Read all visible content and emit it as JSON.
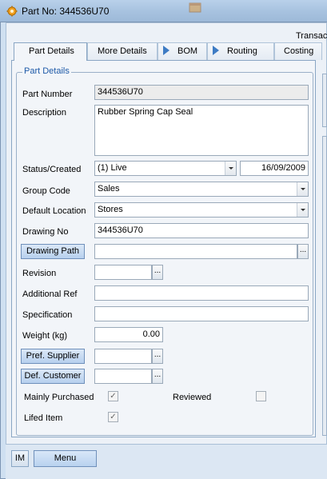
{
  "window": {
    "title": "Part No: 344536U70",
    "header_right": "Transact"
  },
  "tabs": [
    {
      "label": "Part Details",
      "active": true
    },
    {
      "label": "More Details"
    },
    {
      "label": "BOM"
    },
    {
      "label": "Routing"
    },
    {
      "label": "Costing"
    }
  ],
  "group": {
    "title": "Part Details"
  },
  "form": {
    "part_number": {
      "label": "Part Number",
      "value": "344536U70"
    },
    "description": {
      "label": "Description",
      "value": "Rubber Spring Cap Seal"
    },
    "status": {
      "label": "Status/Created",
      "value": "(1) Live",
      "created": "16/09/2009"
    },
    "group_code": {
      "label": "Group Code",
      "value": "Sales"
    },
    "default_location": {
      "label": "Default Location",
      "value": "Stores"
    },
    "drawing_no": {
      "label": "Drawing No",
      "value": "344536U70"
    },
    "drawing_path": {
      "button": "Drawing Path",
      "value": ""
    },
    "revision": {
      "label": "Revision",
      "value": ""
    },
    "additional_ref": {
      "label": "Additional Ref",
      "value": ""
    },
    "specification": {
      "label": "Specification",
      "value": ""
    },
    "weight": {
      "label": "Weight (kg)",
      "value": "0.00"
    },
    "pref_supplier": {
      "button": "Pref. Supplier",
      "value": ""
    },
    "def_customer": {
      "button": "Def. Customer",
      "value": ""
    },
    "mainly_purchased": {
      "label": "Mainly Purchased",
      "checked": true
    },
    "reviewed": {
      "label": "Reviewed",
      "checked": false
    },
    "lifed_item": {
      "label": "Lifed Item",
      "checked": true
    }
  },
  "footer": {
    "im": "IM",
    "menu": "Menu"
  },
  "ellipsis": "...",
  "check_mark": "✓",
  "icons": {
    "title": "gear-icon",
    "background_window": "window-icon",
    "tab_arrow": "play-arrow-icon"
  },
  "colors": {
    "accent": "#3d7bc4",
    "legend": "#1e5aa8",
    "button": "#b7d0ee"
  }
}
